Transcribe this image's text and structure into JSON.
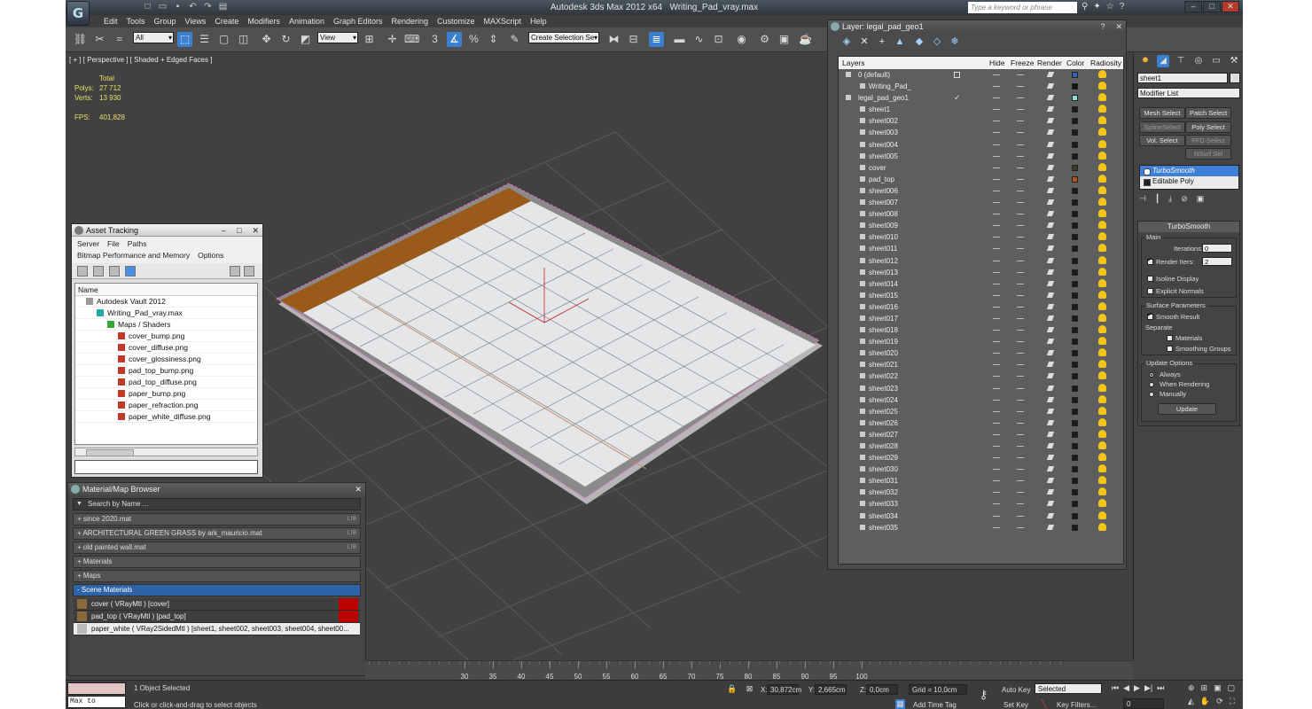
{
  "window": {
    "app_title": "Autodesk 3ds Max  2012 x64",
    "file_title": "Writing_Pad_vray.max",
    "search_placeholder": "Type a keyword or phrase"
  },
  "menu": [
    "Edit",
    "Tools",
    "Group",
    "Views",
    "Create",
    "Modifiers",
    "Animation",
    "Graph Editors",
    "Rendering",
    "Customize",
    "MAXScript",
    "Help"
  ],
  "toolbar": {
    "filter_value": "All",
    "refcoord_value": "View",
    "selection_set_value": "Create Selection Se"
  },
  "viewport": {
    "label": "[ + ] [ Perspective ] [ Shaded + Edged Faces ]",
    "stats_header": "Total",
    "polys_label": "Polys:",
    "polys_value": "27 712",
    "verts_label": "Verts:",
    "verts_value": "13 930",
    "fps_label": "FPS:",
    "fps_value": "401,828"
  },
  "asset_tracking": {
    "title": "Asset Tracking",
    "menu_row1": [
      "Server",
      "File",
      "Paths"
    ],
    "menu_row2": [
      "Bitmap Performance and Memory",
      "Options"
    ],
    "column": "Name",
    "items": [
      {
        "label": "Autodesk Vault 2012",
        "indent": 1,
        "icon": "gray"
      },
      {
        "label": "Writing_Pad_vray.max",
        "indent": 2,
        "icon": "teal"
      },
      {
        "label": "Maps / Shaders",
        "indent": 3,
        "icon": "green"
      },
      {
        "label": "cover_bump.png",
        "indent": 4,
        "icon": "red"
      },
      {
        "label": "cover_diffuse.png",
        "indent": 4,
        "icon": "red"
      },
      {
        "label": "cover_glossiness.png",
        "indent": 4,
        "icon": "red"
      },
      {
        "label": "pad_top_bump.png",
        "indent": 4,
        "icon": "red"
      },
      {
        "label": "pad_top_diffuse.png",
        "indent": 4,
        "icon": "red"
      },
      {
        "label": "paper_bump.png",
        "indent": 4,
        "icon": "red"
      },
      {
        "label": "paper_refraction.png",
        "indent": 4,
        "icon": "red"
      },
      {
        "label": "paper_white_diffuse.png",
        "indent": 4,
        "icon": "red"
      }
    ]
  },
  "material_browser": {
    "title": "Material/Map Browser",
    "search_placeholder": "Search by Name ...",
    "libraries": [
      {
        "label": "+ since 2020.mat",
        "tag": "LIB"
      },
      {
        "label": "+ ARCHITECTURAL GREEN GRASS by ark_mauricio.mat",
        "tag": "LIB"
      },
      {
        "label": "+ old painted wall.mat",
        "tag": "LIB"
      },
      {
        "label": "+ Materials",
        "tag": ""
      },
      {
        "label": "+ Maps",
        "tag": ""
      }
    ],
    "scene_group": "- Scene Materials",
    "scene_items": [
      "cover  ( VRayMtl ) [cover]",
      "pad_top  ( VRayMtl ) [pad_top]",
      "paper_white  ( VRay2SidedMtl ) [sheet1, sheet002, sheet003, sheet004, sheet00..."
    ]
  },
  "layer_manager": {
    "title": "Layer: legal_pad_geo1",
    "columns": {
      "layers": "Layers",
      "hide": "Hide",
      "freeze": "Freeze",
      "render": "Render",
      "color": "Color",
      "radiosity": "Radiosity"
    },
    "rows": [
      {
        "name": "0 (default)",
        "level": 0,
        "marker": "box",
        "color": "#2a63b8"
      },
      {
        "name": "Writing_Pad_",
        "level": 1,
        "marker": "",
        "color": "#111111"
      },
      {
        "name": "legal_pad_geo1",
        "level": 0,
        "marker": "check",
        "color": "#8be0d8"
      },
      {
        "name": "sheet1",
        "level": 1,
        "marker": "",
        "color": "#1a1a1a"
      },
      {
        "name": "sheet002",
        "level": 1,
        "marker": "",
        "color": "#1a1a1a"
      },
      {
        "name": "sheet003",
        "level": 1,
        "marker": "",
        "color": "#1a1a1a"
      },
      {
        "name": "sheet004",
        "level": 1,
        "marker": "",
        "color": "#1a1a1a"
      },
      {
        "name": "sheet005",
        "level": 1,
        "marker": "",
        "color": "#1a1a1a"
      },
      {
        "name": "cover",
        "level": 1,
        "marker": "",
        "color": "#3a3a2a"
      },
      {
        "name": "pad_top",
        "level": 1,
        "marker": "",
        "color": "#b5561c"
      },
      {
        "name": "sheet006",
        "level": 1,
        "marker": "",
        "color": "#1a1a1a"
      },
      {
        "name": "sheet007",
        "level": 1,
        "marker": "",
        "color": "#1a1a1a"
      },
      {
        "name": "sheet008",
        "level": 1,
        "marker": "",
        "color": "#1a1a1a"
      },
      {
        "name": "sheet009",
        "level": 1,
        "marker": "",
        "color": "#1a1a1a"
      },
      {
        "name": "sheet010",
        "level": 1,
        "marker": "",
        "color": "#1a1a1a"
      },
      {
        "name": "sheet011",
        "level": 1,
        "marker": "",
        "color": "#1a1a1a"
      },
      {
        "name": "sheet012",
        "level": 1,
        "marker": "",
        "color": "#1a1a1a"
      },
      {
        "name": "sheet013",
        "level": 1,
        "marker": "",
        "color": "#1a1a1a"
      },
      {
        "name": "sheet014",
        "level": 1,
        "marker": "",
        "color": "#1a1a1a"
      },
      {
        "name": "sheet015",
        "level": 1,
        "marker": "",
        "color": "#1a1a1a"
      },
      {
        "name": "sheet016",
        "level": 1,
        "marker": "",
        "color": "#1a1a1a"
      },
      {
        "name": "sheet017",
        "level": 1,
        "marker": "",
        "color": "#1a1a1a"
      },
      {
        "name": "sheet018",
        "level": 1,
        "marker": "",
        "color": "#1a1a1a"
      },
      {
        "name": "sheet019",
        "level": 1,
        "marker": "",
        "color": "#1a1a1a"
      },
      {
        "name": "sheet020",
        "level": 1,
        "marker": "",
        "color": "#1a1a1a"
      },
      {
        "name": "sheet021",
        "level": 1,
        "marker": "",
        "color": "#1a1a1a"
      },
      {
        "name": "sheet022",
        "level": 1,
        "marker": "",
        "color": "#1a1a1a"
      },
      {
        "name": "sheet023",
        "level": 1,
        "marker": "",
        "color": "#1a1a1a"
      },
      {
        "name": "sheet024",
        "level": 1,
        "marker": "",
        "color": "#1a1a1a"
      },
      {
        "name": "sheet025",
        "level": 1,
        "marker": "",
        "color": "#1a1a1a"
      },
      {
        "name": "sheet026",
        "level": 1,
        "marker": "",
        "color": "#1a1a1a"
      },
      {
        "name": "sheet027",
        "level": 1,
        "marker": "",
        "color": "#1a1a1a"
      },
      {
        "name": "sheet028",
        "level": 1,
        "marker": "",
        "color": "#1a1a1a"
      },
      {
        "name": "sheet029",
        "level": 1,
        "marker": "",
        "color": "#1a1a1a"
      },
      {
        "name": "sheet030",
        "level": 1,
        "marker": "",
        "color": "#1a1a1a"
      },
      {
        "name": "sheet031",
        "level": 1,
        "marker": "",
        "color": "#1a1a1a"
      },
      {
        "name": "sheet032",
        "level": 1,
        "marker": "",
        "color": "#1a1a1a"
      },
      {
        "name": "sheet033",
        "level": 1,
        "marker": "",
        "color": "#1a1a1a"
      },
      {
        "name": "sheet034",
        "level": 1,
        "marker": "",
        "color": "#1a1a1a"
      },
      {
        "name": "sheet035",
        "level": 1,
        "marker": "",
        "color": "#1a1a1a"
      }
    ]
  },
  "command_panel": {
    "object_name": "sheet1",
    "modifier_list": "Modifier List",
    "buttons": [
      "Mesh Select",
      "Patch Select",
      "SplineSelect",
      "Poly Select",
      "Vol. Select",
      "FFD Select",
      "NSurf Sel"
    ],
    "stack": [
      "TurboSmooth",
      "Editable Poly"
    ],
    "rollout_title": "TurboSmooth",
    "main_group": "Main",
    "iterations_label": "Iterations:",
    "iterations_value": "0",
    "render_iters_label": "Render Iters:",
    "render_iters_value": "2",
    "isoline_label": "Isoline Display",
    "explicit_label": "Explicit Normals",
    "surface_group": "Surface Parameters",
    "smooth_result_label": "Smooth Result",
    "separate_label": "Separate",
    "materials_label": "Materials",
    "smoothing_groups_label": "Smoothing Groups",
    "update_group": "Update Options",
    "always_label": "Always",
    "when_rendering_label": "When Rendering",
    "manually_label": "Manually",
    "update_button": "Update"
  },
  "timeline": {
    "ticks": [
      "30",
      "35",
      "40",
      "45",
      "50",
      "55",
      "60",
      "65",
      "70",
      "75",
      "80",
      "85",
      "90",
      "95",
      "100"
    ]
  },
  "status": {
    "maxscript": "Max to Physc.",
    "selected": "1 Object Selected",
    "prompt": "Click or click-and-drag to select objects",
    "x_label": "X:",
    "x_value": "30,872cm",
    "y_label": "Y:",
    "y_value": "2,665cm",
    "z_label": "Z:",
    "z_value": "0,0cm",
    "grid": "Grid = 10,0cm",
    "add_time_tag": "Add Time Tag",
    "auto_key": "Auto Key",
    "selected_dropdown": "Selected",
    "set_key": "Set Key",
    "key_filters": "Key Filters...",
    "frame": "0"
  }
}
